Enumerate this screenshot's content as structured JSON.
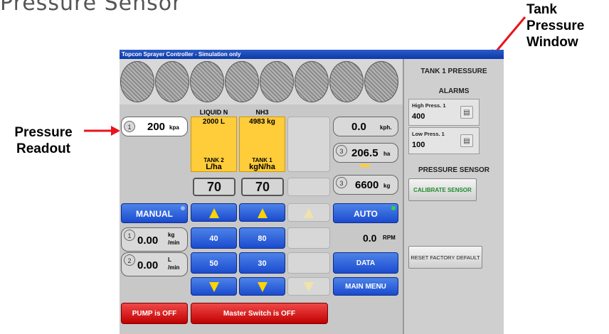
{
  "caption": "Pressure Sensor",
  "annotations": {
    "pressure_readout": [
      "Pressure",
      "Readout"
    ],
    "tank_pressure_window": [
      "Tank",
      "Pressure",
      "Window"
    ]
  },
  "window": {
    "title": "Topcon Sprayer Controller - Simulation only"
  },
  "left": {
    "pressure_value": "200",
    "pressure_unit": "kpa",
    "manual_label": "MANUAL",
    "rate1_value": "0.00",
    "rate1_unit_top": "kg",
    "rate1_unit_bottom": "/min",
    "rate2_value": "0.00",
    "rate2_unit_top": "L",
    "rate2_unit_bottom": "/min",
    "pump_label": "PUMP is OFF"
  },
  "tanks": [
    {
      "header": "LIQUID N",
      "amount": "2000 L",
      "tank_label": "TANK 2",
      "unit": "L/ha",
      "rate": "70",
      "preset1": "40",
      "preset2": "50"
    },
    {
      "header": "NH3",
      "amount": "4983 kg",
      "tank_label": "TANK 1",
      "unit": "kgN/ha",
      "rate": "70",
      "preset1": "80",
      "preset2": "30"
    }
  ],
  "master_switch_label": "Master Switch is OFF",
  "right": {
    "speed_value": "0.0",
    "speed_unit": "kph.",
    "area_value": "206.5",
    "area_unit": "ha",
    "weight_value": "6600",
    "weight_unit": "kg",
    "auto_label": "AUTO",
    "rpm_value": "0.0",
    "rpm_unit": "RPM",
    "data_label": "DATA",
    "main_menu_label": "MAIN MENU",
    "badge3": "3"
  },
  "badges": {
    "one": "1",
    "two": "2"
  },
  "side_panel": {
    "title": "TANK 1 PRESSURE",
    "alarms_title": "ALARMS",
    "high_label": "High Press. 1",
    "high_value": "400",
    "low_label": "Low Press. 1",
    "low_value": "100",
    "sensor_title": "PRESSURE SENSOR",
    "calibrate_label": "CALIBRATE SENSOR",
    "reset_label": "RESET FACTORY DEFAULT"
  },
  "colors": {
    "arrow": "#e8141e",
    "yellow": "#ffcc3a",
    "blue": "#1b4bcf",
    "red": "#c10000",
    "green_text": "#1f8a2c"
  }
}
